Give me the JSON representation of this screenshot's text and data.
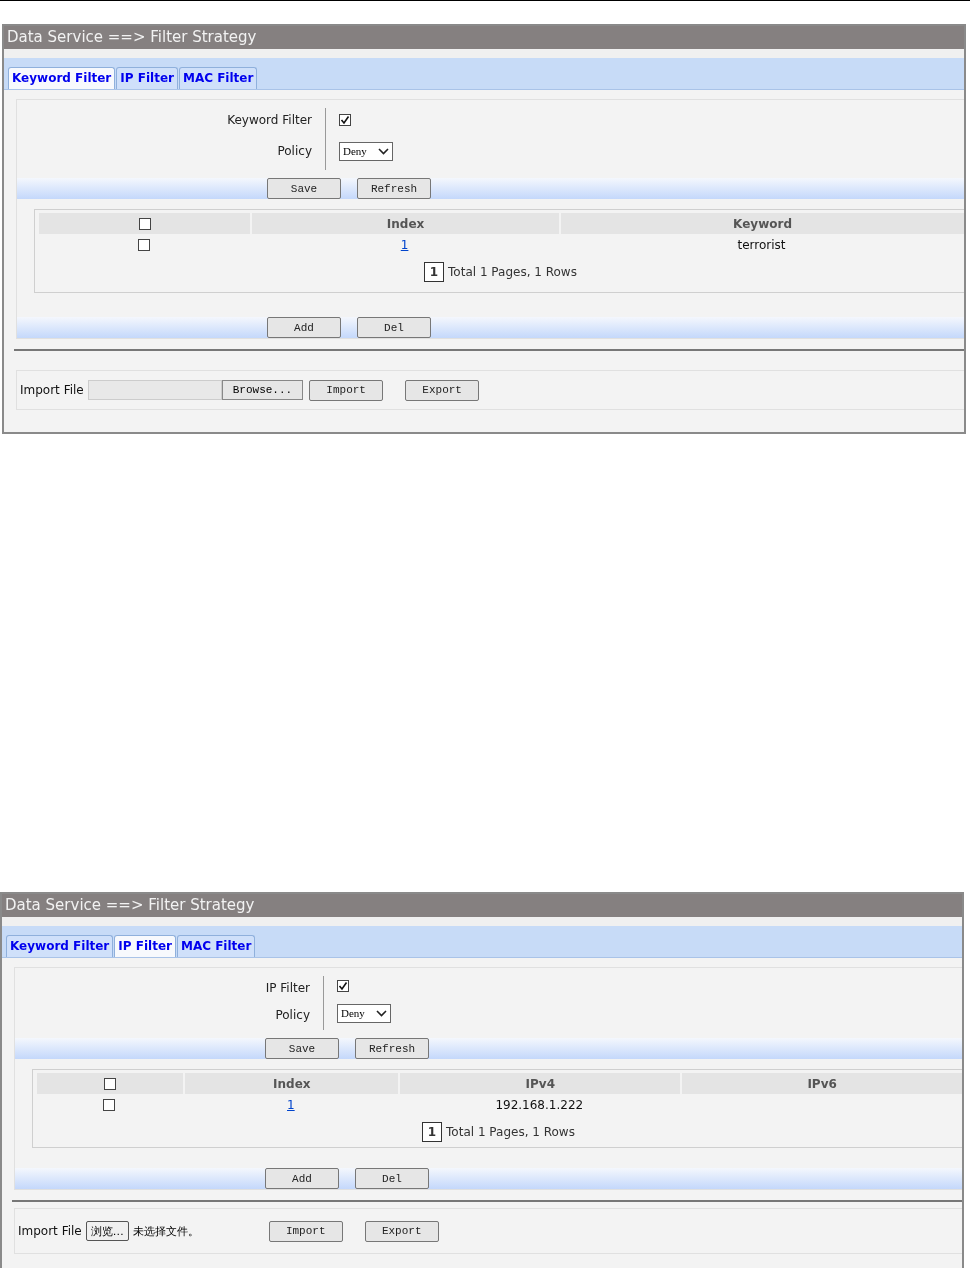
{
  "panels": [
    {
      "title": "Data Service ==> Filter Strategy",
      "tabs": [
        {
          "label": "Keyword Filter",
          "selected": true
        },
        {
          "label": "IP Filter",
          "selected": false
        },
        {
          "label": "MAC Filter",
          "selected": false
        }
      ],
      "toggle": {
        "label": "Keyword Filter",
        "checked": true
      },
      "policy": {
        "label": "Policy",
        "value": "Deny"
      },
      "top_buttons": [
        "Save",
        "Refresh"
      ],
      "table": {
        "select_all": {
          "checked": false
        },
        "columns": [
          "Index",
          "Keyword"
        ],
        "rows": [
          {
            "checked": false,
            "cells": [
              "1",
              "terrorist"
            ]
          }
        ]
      },
      "pager": {
        "page": "1",
        "summary": "Total 1 Pages, 1 Rows"
      },
      "bottom_buttons": [
        "Add",
        "Del"
      ],
      "import": {
        "label": "Import File",
        "kind": "text_field",
        "browse": "Browse...",
        "buttons": [
          "Import",
          "Export"
        ]
      }
    },
    {
      "title": "Data Service ==> Filter Strategy",
      "tabs": [
        {
          "label": "Keyword Filter",
          "selected": false
        },
        {
          "label": "IP Filter",
          "selected": true
        },
        {
          "label": "MAC Filter",
          "selected": false
        }
      ],
      "toggle": {
        "label": "IP Filter",
        "checked": true
      },
      "policy": {
        "label": "Policy",
        "value": "Deny"
      },
      "top_buttons": [
        "Save",
        "Refresh"
      ],
      "table": {
        "select_all": {
          "checked": false
        },
        "columns": [
          "Index",
          "IPv4",
          "IPv6"
        ],
        "rows": [
          {
            "checked": false,
            "cells": [
              "1",
              "192.168.1.222",
              ""
            ]
          }
        ]
      },
      "pager": {
        "page": "1",
        "summary": "Total 1 Pages, 1 Rows"
      },
      "bottom_buttons": [
        "Add",
        "Del"
      ],
      "import": {
        "label": "Import File",
        "kind": "file_button",
        "browse": "浏览…",
        "file_status": "未选择文件。",
        "buttons": [
          "Import",
          "Export"
        ]
      }
    }
  ]
}
